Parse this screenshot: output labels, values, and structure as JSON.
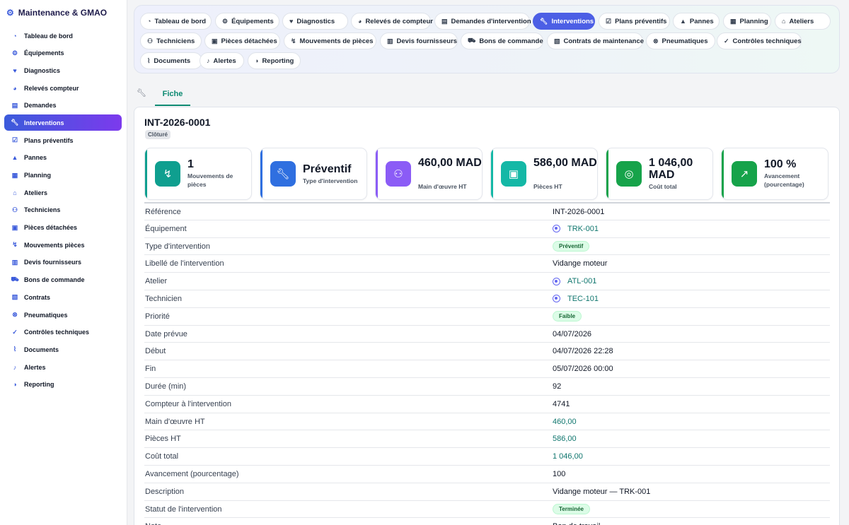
{
  "sidebar": {
    "brand": "Maintenance & GMAO",
    "brand_icon": "cogs-icon",
    "items": [
      {
        "label": "Tableau de bord",
        "icon": "dashboard-icon"
      },
      {
        "label": "Équipements",
        "icon": "cogs-icon"
      },
      {
        "label": "Diagnostics",
        "icon": "heartbeat-icon"
      },
      {
        "label": "Relevés compteur",
        "icon": "gauge-icon"
      },
      {
        "label": "Demandes",
        "icon": "clipboard-icon"
      },
      {
        "label": "Interventions",
        "icon": "wrench-icon",
        "active": true
      },
      {
        "label": "Plans préventifs",
        "icon": "calendar-check-icon"
      },
      {
        "label": "Pannes",
        "icon": "warning-icon"
      },
      {
        "label": "Planning",
        "icon": "calendar-icon"
      },
      {
        "label": "Ateliers",
        "icon": "warehouse-icon"
      },
      {
        "label": "Techniciens",
        "icon": "user-cog-icon"
      },
      {
        "label": "Pièces détachées",
        "icon": "box-icon"
      },
      {
        "label": "Mouvements pièces",
        "icon": "dolly-icon"
      },
      {
        "label": "Devis fournisseurs",
        "icon": "file-invoice-icon"
      },
      {
        "label": "Bons de commande",
        "icon": "cart-icon"
      },
      {
        "label": "Contrats",
        "icon": "file-contract-icon"
      },
      {
        "label": "Pneumatiques",
        "icon": "tire-icon"
      },
      {
        "label": "Contrôles techniques",
        "icon": "clipboard-check-icon"
      },
      {
        "label": "Documents",
        "icon": "paperclip-icon"
      },
      {
        "label": "Alertes",
        "icon": "bell-icon"
      },
      {
        "label": "Reporting",
        "icon": "pie-chart-icon"
      }
    ]
  },
  "topnav": {
    "items": [
      {
        "label": "Tableau de bord",
        "icon": "dashboard-icon"
      },
      {
        "label": "Équipements",
        "icon": "cogs-icon"
      },
      {
        "label": "Diagnostics",
        "icon": "heartbeat-icon"
      },
      {
        "label": "Relevés de compteur",
        "icon": "gauge-icon"
      },
      {
        "label": "Demandes d'intervention",
        "icon": "clipboard-icon"
      },
      {
        "label": "Interventions",
        "icon": "wrench-icon",
        "active": true
      },
      {
        "label": "Plans préventifs",
        "icon": "calendar-check-icon"
      },
      {
        "label": "Pannes",
        "icon": "warning-icon"
      },
      {
        "label": "Planning",
        "icon": "calendar-icon"
      },
      {
        "label": "Ateliers",
        "icon": "warehouse-icon"
      },
      {
        "label": "Techniciens",
        "icon": "user-cog-icon"
      },
      {
        "label": "Pièces détachées",
        "icon": "box-icon"
      },
      {
        "label": "Mouvements de pièces",
        "icon": "dolly-icon"
      },
      {
        "label": "Devis fournisseurs",
        "icon": "file-invoice-icon"
      },
      {
        "label": "Bons de commande",
        "icon": "cart-icon"
      },
      {
        "label": "Contrats de maintenance",
        "icon": "file-contract-icon"
      },
      {
        "label": "Pneumatiques",
        "icon": "tire-icon"
      },
      {
        "label": "Contrôles techniques",
        "icon": "clipboard-check-icon"
      },
      {
        "label": "Documents",
        "icon": "paperclip-icon"
      },
      {
        "label": "Alertes",
        "icon": "bell-icon"
      },
      {
        "label": "Reporting",
        "icon": "pie-chart-icon"
      }
    ]
  },
  "tabs": {
    "active": "Fiche",
    "icon": "wrench-icon"
  },
  "record": {
    "title": "INT-2026-0001",
    "status": "Clôturé"
  },
  "kpis": [
    {
      "value": "1",
      "label": "Mouvements de pièces",
      "icon": "dolly-icon",
      "accent": "#0f9f8f"
    },
    {
      "value": "Préventif",
      "label": "Type d'intervention",
      "icon": "wrench-icon",
      "accent": "#2f6fe0"
    },
    {
      "value": "460,00 MAD",
      "label": "Main d'œuvre HT",
      "icon": "user-cog-icon",
      "accent": "#8b5cf6"
    },
    {
      "value": "586,00 MAD",
      "label": "Pièces HT",
      "icon": "box-icon",
      "accent": "#14b8a6"
    },
    {
      "value": "1 046,00 MAD",
      "label": "Coût total",
      "icon": "coins-icon",
      "accent": "#16a34a"
    },
    {
      "value": "100 %",
      "label": "Avancement (pourcentage)",
      "icon": "chart-line-icon",
      "accent": "#16a34a"
    }
  ],
  "fields": [
    {
      "label": "Référence",
      "value": "INT-2026-0001",
      "kind": "text"
    },
    {
      "label": "Équipement",
      "value": "TRK-001",
      "kind": "link"
    },
    {
      "label": "Type d'intervention",
      "value": "Préventif",
      "kind": "badge"
    },
    {
      "label": "Libellé de l'intervention",
      "value": "Vidange moteur",
      "kind": "text"
    },
    {
      "label": "Atelier",
      "value": "ATL-001",
      "kind": "link"
    },
    {
      "label": "Technicien",
      "value": "TEC-101",
      "kind": "link"
    },
    {
      "label": "Priorité",
      "value": "Faible",
      "kind": "badge"
    },
    {
      "label": "Date prévue",
      "value": "04/07/2026",
      "kind": "text"
    },
    {
      "label": "Début",
      "value": "04/07/2026 22:28",
      "kind": "text"
    },
    {
      "label": "Fin",
      "value": "05/07/2026 00:00",
      "kind": "text"
    },
    {
      "label": "Durée (min)",
      "value": "92",
      "kind": "text"
    },
    {
      "label": "Compteur à l'intervention",
      "value": "4741",
      "kind": "text"
    },
    {
      "label": "Main d'œuvre HT",
      "value": "460,00",
      "kind": "num"
    },
    {
      "label": "Pièces HT",
      "value": "586,00",
      "kind": "num"
    },
    {
      "label": "Coût total",
      "value": "1 046,00",
      "kind": "num"
    },
    {
      "label": "Avancement (pourcentage)",
      "value": "100",
      "kind": "text"
    },
    {
      "label": "Description",
      "value": "Vidange moteur — TRK-001",
      "kind": "text"
    },
    {
      "label": "Statut de l'intervention",
      "value": "Terminée",
      "kind": "badge"
    },
    {
      "label": "Note",
      "value": "Bon de travail",
      "kind": "text"
    }
  ]
}
